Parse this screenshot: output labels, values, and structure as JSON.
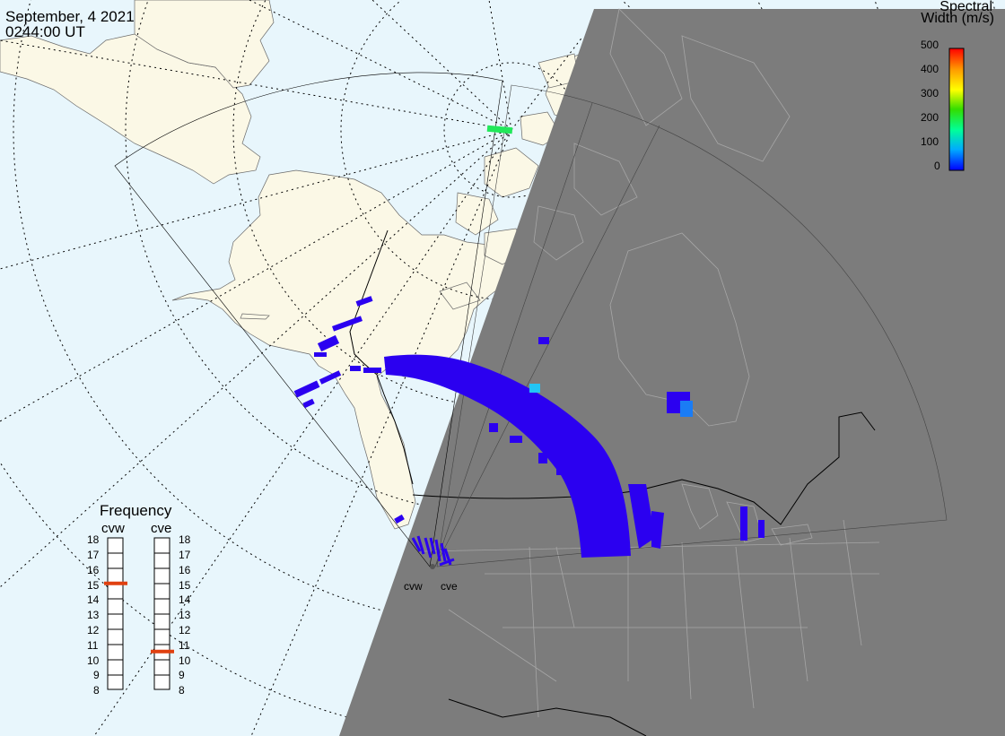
{
  "timestamp": {
    "date": "September, 4 2021",
    "time": "0244:00 UT"
  },
  "colorbar": {
    "title_line1": "Spectral",
    "title_line2": "Width (m/s)",
    "ticks": [
      "500",
      "400",
      "300",
      "200",
      "100",
      "0"
    ],
    "min": 0,
    "max": 500,
    "colors": [
      "#0000ff",
      "#00aaff",
      "#00ff99",
      "#33dd00",
      "#ffff00",
      "#ff9900",
      "#ff0000"
    ]
  },
  "frequency": {
    "title": "Frequency",
    "levels": [
      "18",
      "17",
      "16",
      "15",
      "14",
      "13",
      "12",
      "11",
      "10",
      "9",
      "8"
    ],
    "radars": [
      {
        "name": "cvw",
        "frequency_mhz": 15
      },
      {
        "name": "cve",
        "frequency_mhz": 10.5
      }
    ],
    "marker_color": "#e04010"
  },
  "stations": [
    {
      "name": "cvw"
    },
    {
      "name": "cve"
    }
  ],
  "map_colors": {
    "ocean": "#e8f6fc",
    "land": "#fbf8e6",
    "night": "#7c7c7c",
    "night_border": "#a6a6a6",
    "scatter_low": "#2b00f0",
    "scatter_mid": "#1a7cf5",
    "scatter_cyan": "#22c5f5",
    "scatter_green": "#22e85a"
  }
}
